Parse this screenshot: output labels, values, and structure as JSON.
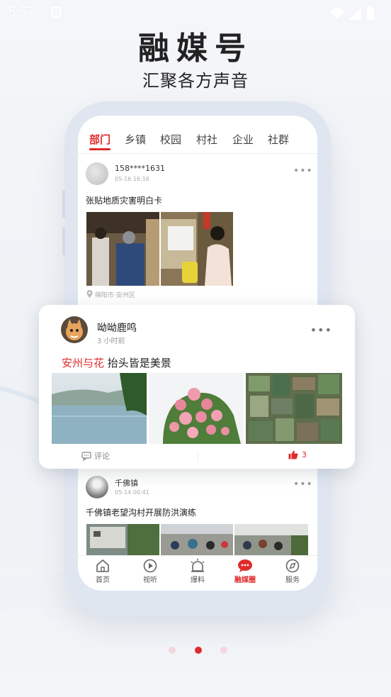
{
  "status_bar": {
    "time": "5:57",
    "notification_icon": "a-letter-icon",
    "icons": [
      "wifi-icon",
      "signal-icon",
      "battery-icon"
    ]
  },
  "hero": {
    "title": "融媒号",
    "subtitle": "汇聚各方声音"
  },
  "phone": {
    "tabs": [
      {
        "label": "部门",
        "active": true
      },
      {
        "label": "乡镇",
        "active": false
      },
      {
        "label": "校园",
        "active": false
      },
      {
        "label": "村社",
        "active": false
      },
      {
        "label": "企业",
        "active": false
      },
      {
        "label": "社群",
        "active": false
      }
    ],
    "posts": [
      {
        "user": "158****1631",
        "time": "05-16 16:16",
        "text": "张贴地质灾害明白卡",
        "location": "绵阳市·安州区"
      },
      {
        "user": "千佛镇",
        "time": "05-14 00:41",
        "text": "千佛镇老望沟村开展防洪演练"
      }
    ],
    "bottom_nav": [
      {
        "label": "首页",
        "icon": "home-icon",
        "active": false
      },
      {
        "label": "视听",
        "icon": "play-icon",
        "active": false
      },
      {
        "label": "爆料",
        "icon": "alarm-light-icon",
        "active": false
      },
      {
        "label": "融媒圈",
        "icon": "chat-bubble-icon",
        "active": true
      },
      {
        "label": "服务",
        "icon": "compass-icon",
        "active": false
      }
    ]
  },
  "featured_card": {
    "user": "呦呦鹿鸣",
    "time": "3 小时前",
    "topic": "安州与花",
    "text": "抬头皆是美景",
    "comment_label": "评论",
    "like_count": "3"
  },
  "pager": {
    "count": 3,
    "active_index": 1
  },
  "colors": {
    "accent": "#e02b2b",
    "inactive_dot": "#f3d6dc",
    "phone_frame": "#dfe6f0"
  }
}
